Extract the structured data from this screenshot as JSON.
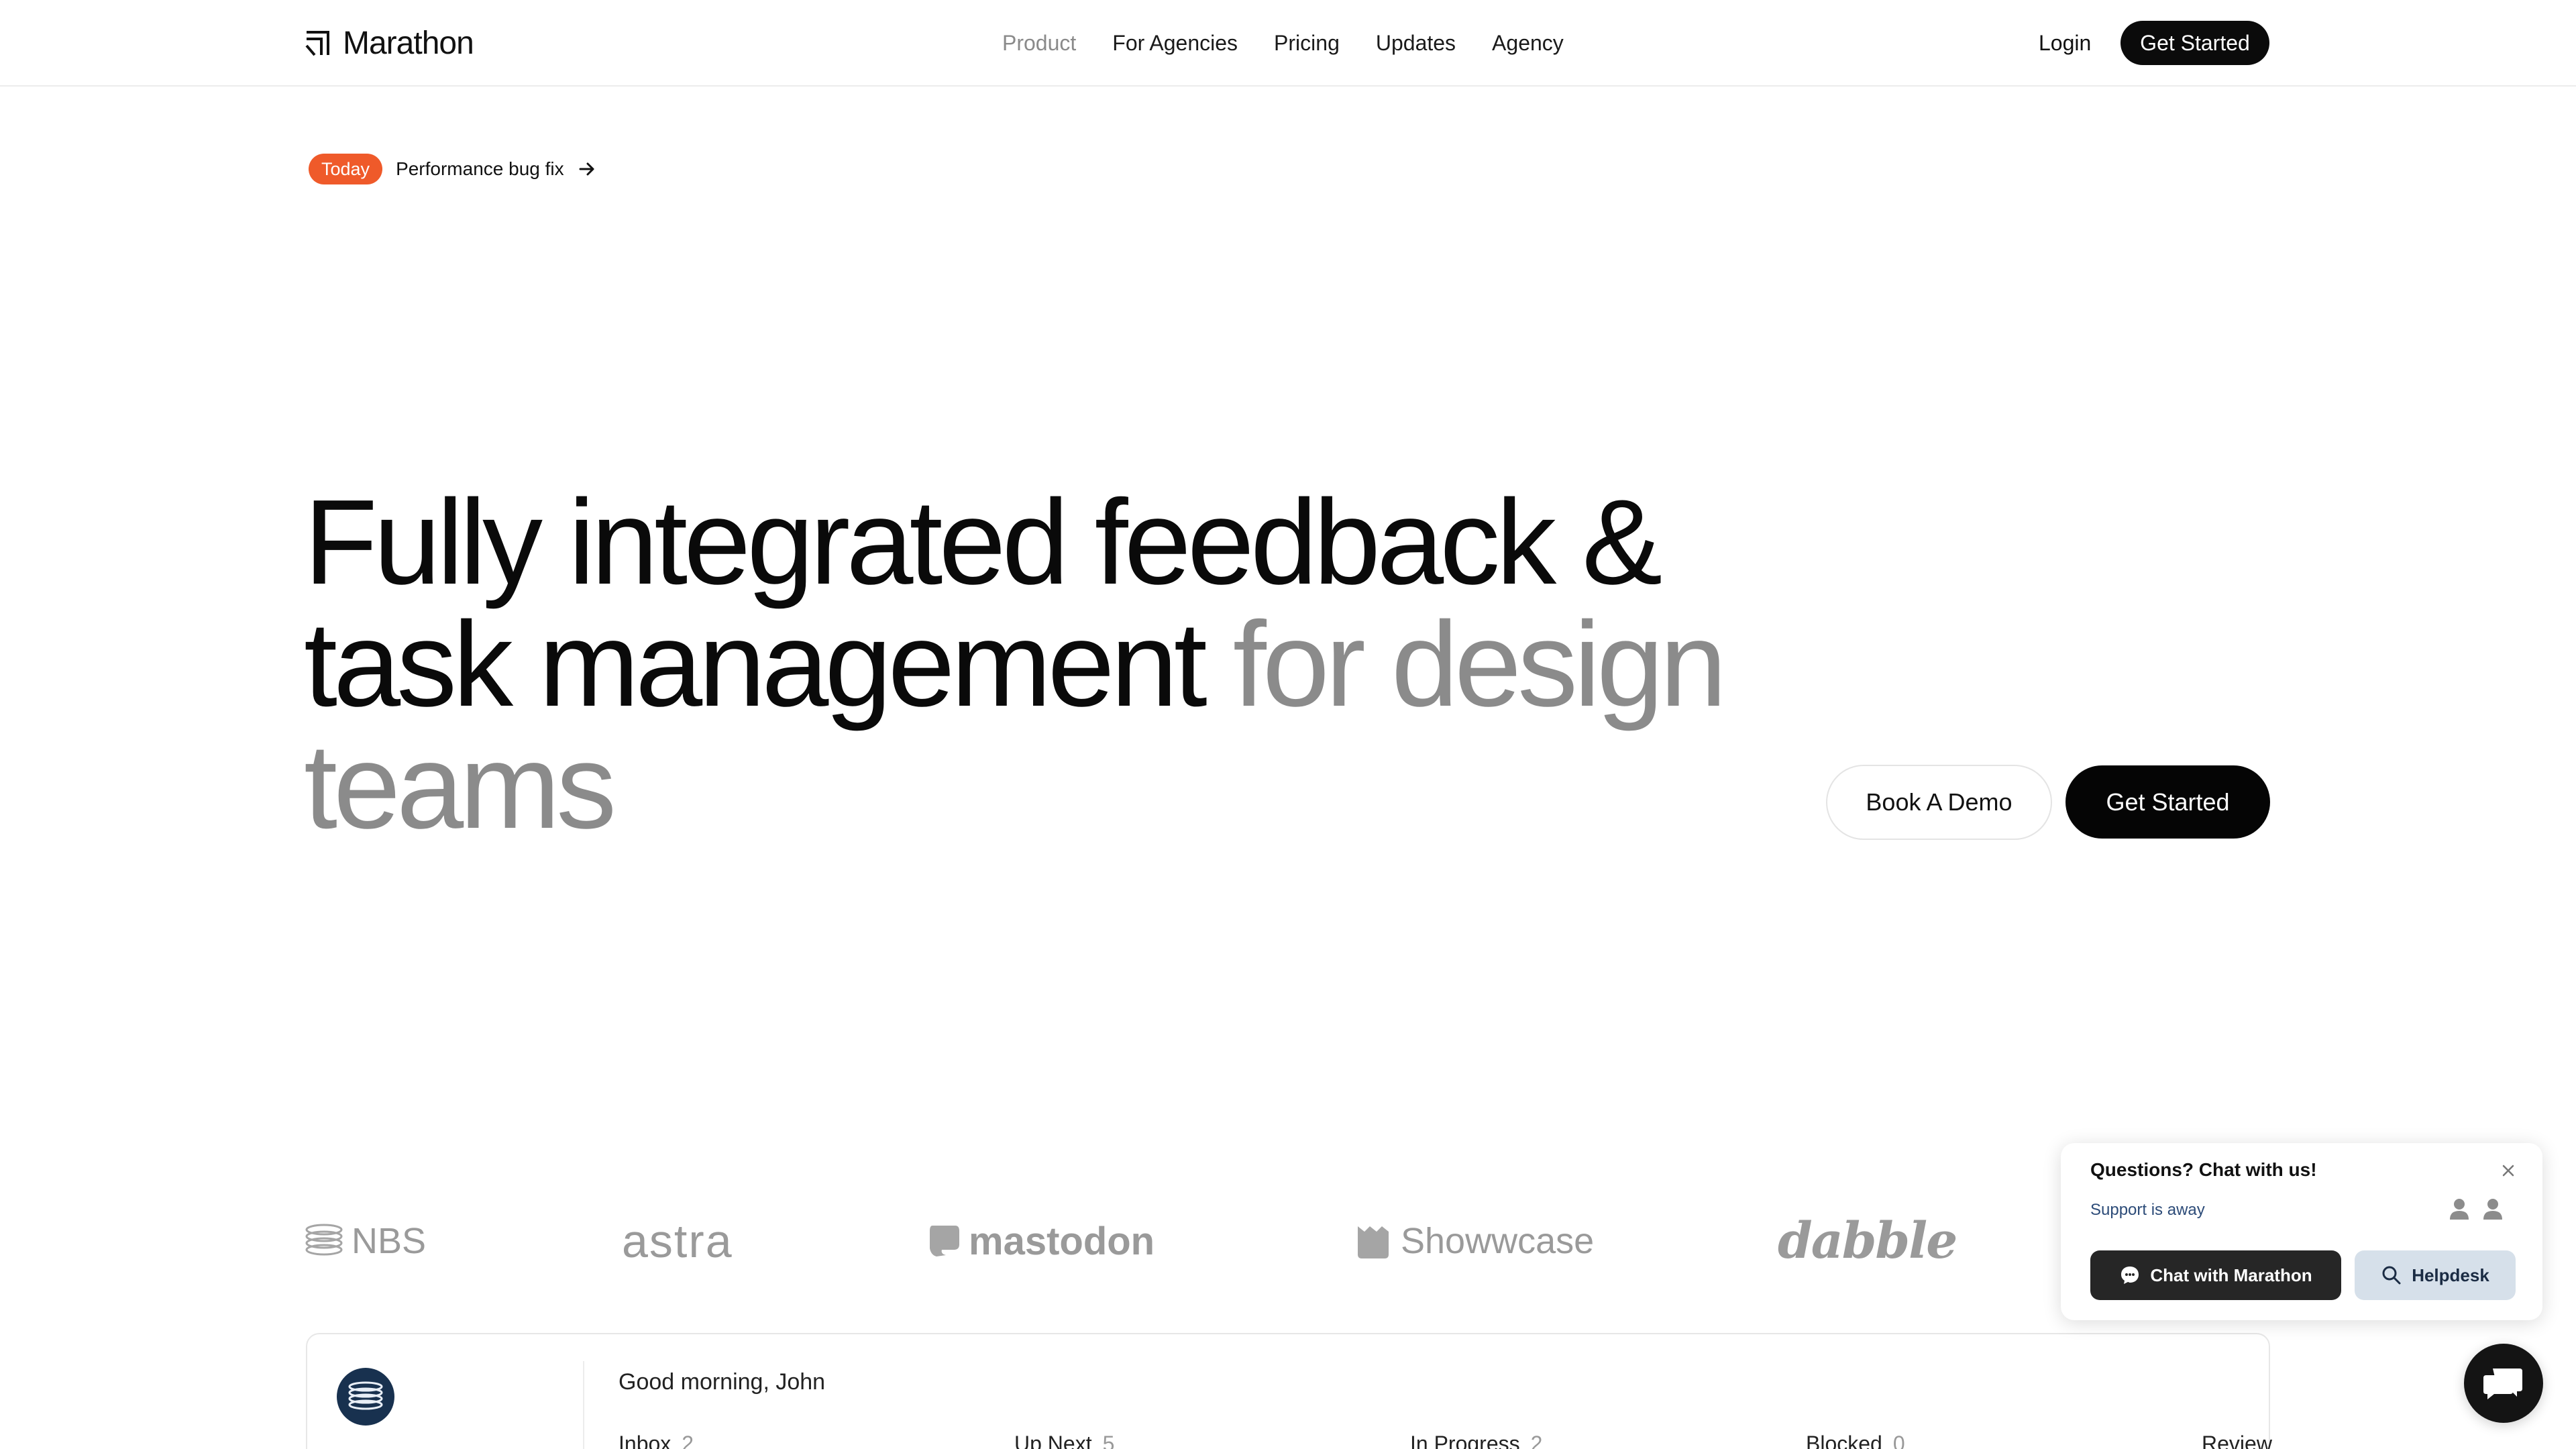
{
  "header": {
    "brand": "Marathon",
    "nav": [
      {
        "label": "Product",
        "active": true
      },
      {
        "label": "For Agencies"
      },
      {
        "label": "Pricing"
      },
      {
        "label": "Updates"
      },
      {
        "label": "Agency"
      }
    ],
    "login_label": "Login",
    "get_started_label": "Get Started"
  },
  "announcement": {
    "badge": "Today",
    "text": "Performance bug fix",
    "icon": "arrow-right-icon",
    "badge_color": "#ef5a2a"
  },
  "hero": {
    "line1": "Fully integrated feedback &",
    "line2_dark": "task management ",
    "line2_muted": "for design",
    "line3_muted": "teams",
    "demo_label": "Book A Demo",
    "get_started_label": "Get Started"
  },
  "clients": [
    "NBS",
    "astra",
    "mastodon",
    "Showwcase",
    "dabble"
  ],
  "preview": {
    "greeting": "Good morning, John",
    "columns": [
      {
        "label": "Inbox",
        "count": "2"
      },
      {
        "label": "Up Next",
        "count": "5"
      },
      {
        "label": "In Progress",
        "count": "2"
      },
      {
        "label": "Blocked",
        "count": "0"
      },
      {
        "label": "Review",
        "count": ""
      }
    ]
  },
  "chat_widget": {
    "title": "Questions? Chat with us!",
    "status": "Support is away",
    "chat_button": "Chat with Marathon",
    "helpdesk_button": "Helpdesk",
    "accent": "#262626",
    "helpdesk_color": "#d6e0ea"
  },
  "colors": {
    "text": "#0a0a0a",
    "muted": "#8b8b8b",
    "button": "#0b0b0b"
  }
}
